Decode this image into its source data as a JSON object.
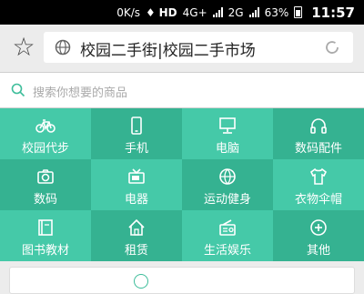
{
  "status_bar": {
    "speed": "0K/s",
    "network_4g": "4G+",
    "network_2g": "2G",
    "battery": "63%",
    "time": "11:57"
  },
  "browser": {
    "url_title": "校园二手街|校园二手市场"
  },
  "search": {
    "placeholder": "搜索你想要的商品"
  },
  "categories": [
    {
      "label": "校园代步",
      "icon": "bicycle-icon"
    },
    {
      "label": "手机",
      "icon": "phone-icon"
    },
    {
      "label": "电脑",
      "icon": "computer-icon"
    },
    {
      "label": "数码配件",
      "icon": "headphones-icon"
    },
    {
      "label": "数码",
      "icon": "camera-icon"
    },
    {
      "label": "电器",
      "icon": "tv-icon"
    },
    {
      "label": "运动健身",
      "icon": "ball-icon"
    },
    {
      "label": "衣物伞帽",
      "icon": "clothes-icon"
    },
    {
      "label": "图书教材",
      "icon": "book-icon"
    },
    {
      "label": "租赁",
      "icon": "house-icon"
    },
    {
      "label": "生活娱乐",
      "icon": "radio-icon"
    },
    {
      "label": "其他",
      "icon": "plus-icon"
    }
  ],
  "colors": {
    "accent_light": "#45c9a8",
    "accent_dark": "#35b291"
  }
}
